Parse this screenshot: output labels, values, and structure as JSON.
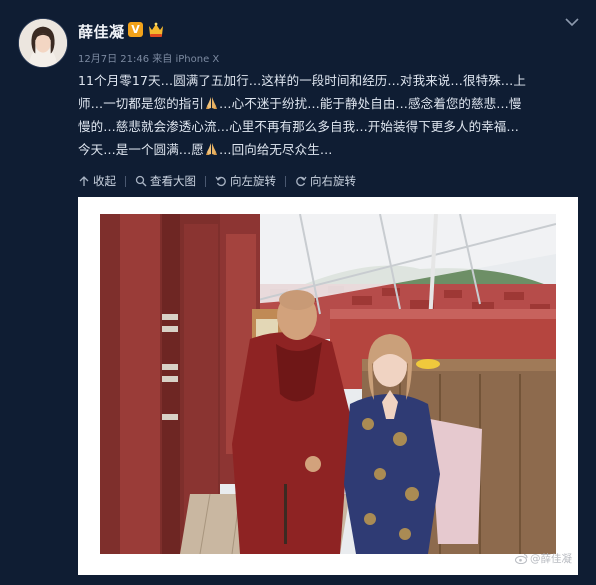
{
  "post": {
    "username": "薛佳凝",
    "verified_badge": "V",
    "timestamp": "12月7日 21:46",
    "source_prefix": "来自",
    "source": "iPhone X",
    "text": {
      "line1": "11个月零17天…圆满了五加行…这样的一段时间和经历…对我来说…很特殊…上",
      "line2_a": "师…一切都是您的指引",
      "line2_b": "…心不迷于纷扰…能于静处自由…感念着您的慈悲…慢",
      "line3": "慢的…慈悲就会渗透心流…心里不再有那么多自我…开始装得下更多人的幸福…",
      "line4_a": "今天…是一个圆满…愿",
      "line4_b": "…回向给无尽众生…"
    },
    "icons": {
      "pray": "folded-hands-emoji",
      "menu": "chevron-down-icon",
      "crown": "member-crown-icon"
    }
  },
  "actions": {
    "collapse": {
      "label": "收起",
      "icon": "arrow-up-icon"
    },
    "view_large": {
      "label": "查看大图",
      "icon": "magnifier-icon"
    },
    "rotate_left": {
      "label": "向左旋转",
      "icon": "rotate-left-icon"
    },
    "rotate_right": {
      "label": "向右旋转",
      "icon": "rotate-right-icon"
    }
  },
  "image": {
    "watermark": "@薛佳凝"
  },
  "colors": {
    "background": "#0f1d33",
    "text": "#dfe6f0",
    "meta": "#7c8aa1",
    "badge": "#f2a21a"
  }
}
